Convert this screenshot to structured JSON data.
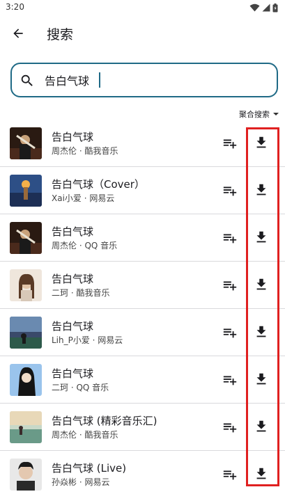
{
  "status_bar": {
    "time": "3:20",
    "icons": [
      "wifi-icon",
      "signal-icon",
      "battery-icon"
    ]
  },
  "app_bar": {
    "back_icon": "arrow-left-icon",
    "title": "搜索"
  },
  "search": {
    "icon": "search-icon",
    "value": "告白气球",
    "accent_color": "#1f6a86"
  },
  "filter": {
    "label": "聚合搜索",
    "icon": "dropdown-arrow-icon"
  },
  "results": [
    {
      "title": "告白气球",
      "subtitle": "周杰伦 · 酷我音乐"
    },
    {
      "title": "告白气球（Cover）",
      "subtitle": "Xai小爱 · 网易云"
    },
    {
      "title": "告白气球",
      "subtitle": "周杰伦 · QQ 音乐"
    },
    {
      "title": "告白气球",
      "subtitle": "二珂 · 酷我音乐"
    },
    {
      "title": "告白气球",
      "subtitle": "Lih_P小爱 · 网易云"
    },
    {
      "title": "告白气球",
      "subtitle": "二珂 · QQ 音乐"
    },
    {
      "title": "告白气球 (精彩音乐汇)",
      "subtitle": "周杰伦 · 酷我音乐"
    },
    {
      "title": "告白气球 (Live)",
      "subtitle": "孙焱彬 · 网易云"
    }
  ],
  "row_actions": {
    "add_icon": "playlist-add-icon",
    "download_icon": "download-icon"
  },
  "annotation": {
    "highlight_color": "#e02020"
  }
}
